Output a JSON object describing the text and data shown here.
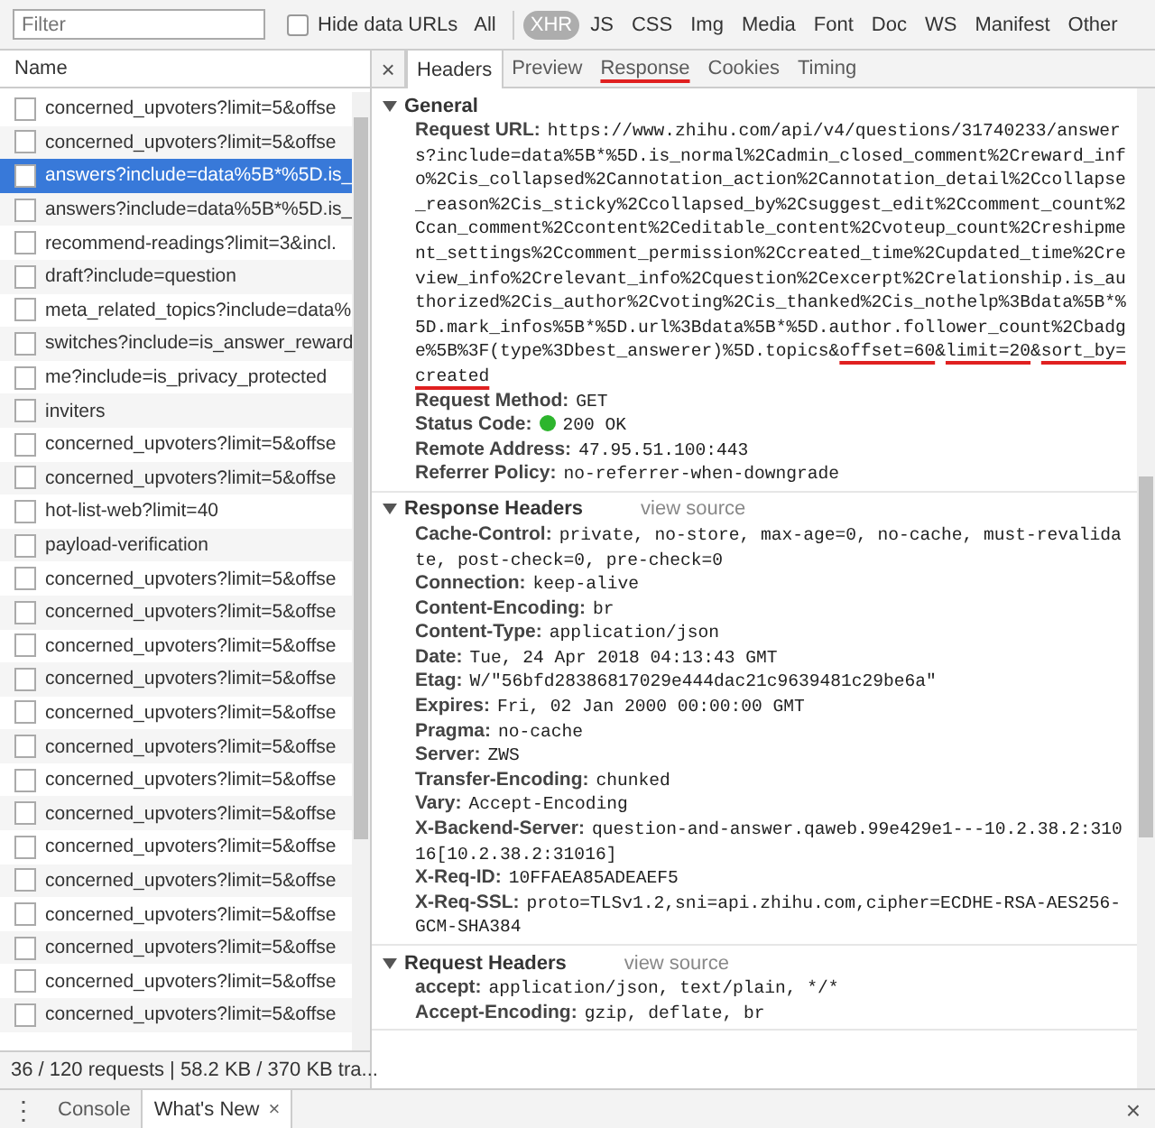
{
  "toolbar": {
    "filter": {
      "placeholder": "Filter"
    },
    "hide_data_urls": {
      "label": "Hide data URLs",
      "checked": false
    },
    "types": [
      {
        "label": "All",
        "selected": false
      },
      {
        "label": "XHR",
        "selected": true
      },
      {
        "label": "JS",
        "selected": false
      },
      {
        "label": "CSS",
        "selected": false
      },
      {
        "label": "Img",
        "selected": false
      },
      {
        "label": "Media",
        "selected": false
      },
      {
        "label": "Font",
        "selected": false
      },
      {
        "label": "Doc",
        "selected": false
      },
      {
        "label": "WS",
        "selected": false
      },
      {
        "label": "Manifest",
        "selected": false
      },
      {
        "label": "Other",
        "selected": false
      }
    ]
  },
  "requests": {
    "column": "Name",
    "rows": [
      {
        "name": "concerned_upvoters?limit=5&offse",
        "selected": false
      },
      {
        "name": "concerned_upvoters?limit=5&offse",
        "selected": false
      },
      {
        "name": "answers?include=data%5B*%5D.is_",
        "selected": true
      },
      {
        "name": "answers?include=data%5B*%5D.is_",
        "selected": false
      },
      {
        "name": "recommend-readings?limit=3&incl.",
        "selected": false
      },
      {
        "name": "draft?include=question",
        "selected": false
      },
      {
        "name": "meta_related_topics?include=data%",
        "selected": false
      },
      {
        "name": "switches?include=is_answer_reward",
        "selected": false
      },
      {
        "name": "me?include=is_privacy_protected",
        "selected": false
      },
      {
        "name": "inviters",
        "selected": false
      },
      {
        "name": "concerned_upvoters?limit=5&offse",
        "selected": false
      },
      {
        "name": "concerned_upvoters?limit=5&offse",
        "selected": false
      },
      {
        "name": "hot-list-web?limit=40",
        "selected": false
      },
      {
        "name": "payload-verification",
        "selected": false
      },
      {
        "name": "concerned_upvoters?limit=5&offse",
        "selected": false
      },
      {
        "name": "concerned_upvoters?limit=5&offse",
        "selected": false
      },
      {
        "name": "concerned_upvoters?limit=5&offse",
        "selected": false
      },
      {
        "name": "concerned_upvoters?limit=5&offse",
        "selected": false
      },
      {
        "name": "concerned_upvoters?limit=5&offse",
        "selected": false
      },
      {
        "name": "concerned_upvoters?limit=5&offse",
        "selected": false
      },
      {
        "name": "concerned_upvoters?limit=5&offse",
        "selected": false
      },
      {
        "name": "concerned_upvoters?limit=5&offse",
        "selected": false
      },
      {
        "name": "concerned_upvoters?limit=5&offse",
        "selected": false
      },
      {
        "name": "concerned_upvoters?limit=5&offse",
        "selected": false
      },
      {
        "name": "concerned_upvoters?limit=5&offse",
        "selected": false
      },
      {
        "name": "concerned_upvoters?limit=5&offse",
        "selected": false
      },
      {
        "name": "concerned_upvoters?limit=5&offse",
        "selected": false
      },
      {
        "name": "concerned_upvoters?limit=5&offse",
        "selected": false
      }
    ],
    "summary": "36 / 120 requests | 58.2 KB / 370 KB tra..."
  },
  "detail": {
    "close": "×",
    "tabs": [
      {
        "label": "Headers",
        "selected": true,
        "underlined": false
      },
      {
        "label": "Preview",
        "selected": false,
        "underlined": false
      },
      {
        "label": "Response",
        "selected": false,
        "underlined": true
      },
      {
        "label": "Cookies",
        "selected": false,
        "underlined": false
      },
      {
        "label": "Timing",
        "selected": false,
        "underlined": false
      }
    ],
    "sections": [
      {
        "title": "General",
        "expanded": true,
        "items": [
          {
            "kind": "url",
            "name": "Request URL:",
            "segments": [
              {
                "text": "https://www.zhihu.com/api/v4/questions/31740233/answers?include=data%5B*%5D.is_normal%2Cadmin_closed_comment%2Creward_info%2Cis_collapsed%2Cannotation_action%2Cannotation_detail%2Ccollapse_reason%2Cis_sticky%2Ccollapsed_by%2Csuggest_edit%2Ccomment_count%2Ccan_comment%2Ccontent%2Ceditable_content%2Cvoteup_count%2Creshipment_settings%2Ccomment_permission%2Ccreated_time%2Cupdated_time%2Creview_info%2Crelevant_info%2Cquestion%2Cexcerpt%2Crelationship.is_authorized%2Cis_author%2Cvoting%2Cis_thanked%2Cis_nothelp%3Bdata%5B*%5D.mark_infos%5B*%5D.url%3Bdata%5B*%5D.author.follower_count%2Cbadge%5B%3F(type%3Dbest_answerer)%5D.topics&",
                "underlined": false
              },
              {
                "text": "offset=60",
                "underlined": true
              },
              {
                "text": "&",
                "underlined": false
              },
              {
                "text": "limit=20",
                "underlined": true
              },
              {
                "text": "&",
                "underlined": false
              },
              {
                "text": "sort_by=created",
                "underlined": true
              }
            ]
          },
          {
            "kind": "plain",
            "name": "Request Method:",
            "value": "GET"
          },
          {
            "kind": "status",
            "name": "Status Code:",
            "value": "200 OK"
          },
          {
            "kind": "plain",
            "name": "Remote Address:",
            "value": "47.95.51.100:443"
          },
          {
            "kind": "plain",
            "name": "Referrer Policy:",
            "value": "no-referrer-when-downgrade"
          }
        ]
      },
      {
        "title": "Response Headers",
        "expanded": true,
        "link": "view source",
        "items": [
          {
            "kind": "plain",
            "name": "Cache-Control:",
            "value": "private, no-store, max-age=0, no-cache, must-revalidate, post-check=0, pre-check=0"
          },
          {
            "kind": "plain",
            "name": "Connection:",
            "value": "keep-alive"
          },
          {
            "kind": "plain",
            "name": "Content-Encoding:",
            "value": "br"
          },
          {
            "kind": "plain",
            "name": "Content-Type:",
            "value": "application/json"
          },
          {
            "kind": "plain",
            "name": "Date:",
            "value": "Tue, 24 Apr 2018 04:13:43 GMT"
          },
          {
            "kind": "plain",
            "name": "Etag:",
            "value": "W/\"56bfd28386817029e444dac21c9639481c29be6a\""
          },
          {
            "kind": "plain",
            "name": "Expires:",
            "value": "Fri, 02 Jan 2000 00:00:00 GMT"
          },
          {
            "kind": "plain",
            "name": "Pragma:",
            "value": "no-cache"
          },
          {
            "kind": "plain",
            "name": "Server:",
            "value": "ZWS"
          },
          {
            "kind": "plain",
            "name": "Transfer-Encoding:",
            "value": "chunked"
          },
          {
            "kind": "plain",
            "name": "Vary:",
            "value": "Accept-Encoding"
          },
          {
            "kind": "plain",
            "name": "X-Backend-Server:",
            "value": "question-and-answer.qaweb.99e429e1---10.2.38.2:31016[10.2.38.2:31016]"
          },
          {
            "kind": "plain",
            "name": "X-Req-ID:",
            "value": "10FFAEA85ADEAEF5"
          },
          {
            "kind": "plain",
            "name": "X-Req-SSL:",
            "value": "proto=TLSv1.2,sni=api.zhihu.com,cipher=ECDHE-RSA-AES256-GCM-SHA384"
          }
        ]
      },
      {
        "title": "Request Headers",
        "expanded": true,
        "link": "view source",
        "items": [
          {
            "kind": "plain",
            "name": "accept:",
            "value": "application/json, text/plain, */*"
          },
          {
            "kind": "plain",
            "name": "Accept-Encoding:",
            "value": "gzip, deflate, br"
          }
        ]
      }
    ]
  },
  "drawer": {
    "menu": "⋮",
    "tabs": [
      {
        "label": "Console",
        "selected": false,
        "closable": false
      },
      {
        "label": "What's New",
        "selected": true,
        "closable": true
      }
    ],
    "tab_close": "×",
    "close": "×"
  }
}
